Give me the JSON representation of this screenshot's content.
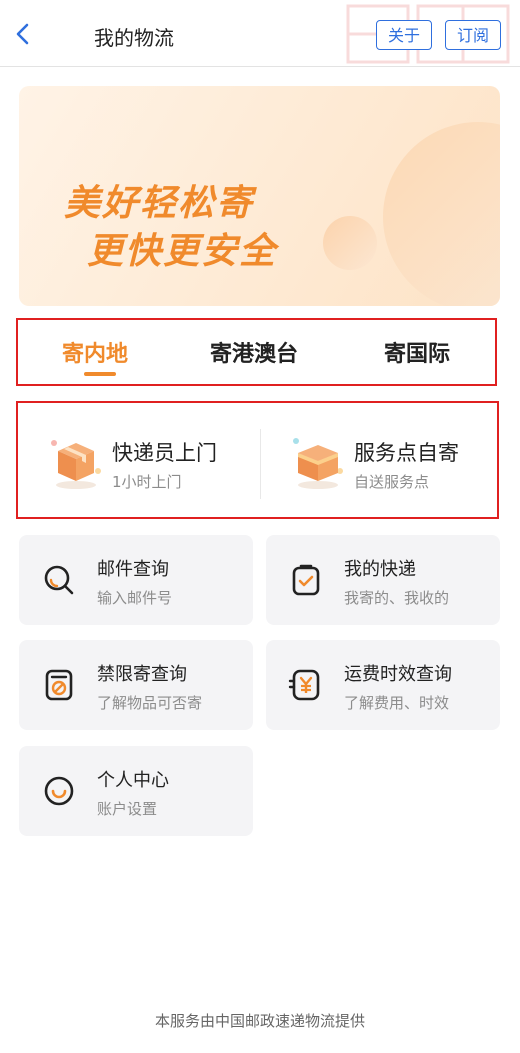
{
  "nav": {
    "title": "我的物流",
    "about_label": "关于",
    "subscribe_label": "订阅"
  },
  "banner": {
    "line1": "美好轻松寄",
    "line2": "更快更安全"
  },
  "tabs": [
    {
      "label": "寄内地",
      "active": true
    },
    {
      "label": "寄港澳台",
      "active": false
    },
    {
      "label": "寄国际",
      "active": false
    }
  ],
  "send_options": [
    {
      "title": "快递员上门",
      "subtitle": "1小时上门",
      "icon": "courier-box-icon"
    },
    {
      "title": "服务点自寄",
      "subtitle": "自送服务点",
      "icon": "service-point-box-icon"
    }
  ],
  "services": [
    {
      "title": "邮件查询",
      "subtitle": "输入邮件号",
      "icon": "search-icon"
    },
    {
      "title": "我的快递",
      "subtitle": "我寄的、我收的",
      "icon": "clipboard-check-icon"
    },
    {
      "title": "禁限寄查询",
      "subtitle": "了解物品可否寄",
      "icon": "prohibited-icon"
    },
    {
      "title": "运费时效查询",
      "subtitle": "了解费用、时效",
      "icon": "yen-icon"
    },
    {
      "title": "个人中心",
      "subtitle": "账户设置",
      "icon": "smile-icon"
    }
  ],
  "footer": "本服务由中国邮政速递物流提供",
  "colors": {
    "accent": "#f08a2c",
    "link": "#2f6fde",
    "highlight_border": "#e02020"
  }
}
